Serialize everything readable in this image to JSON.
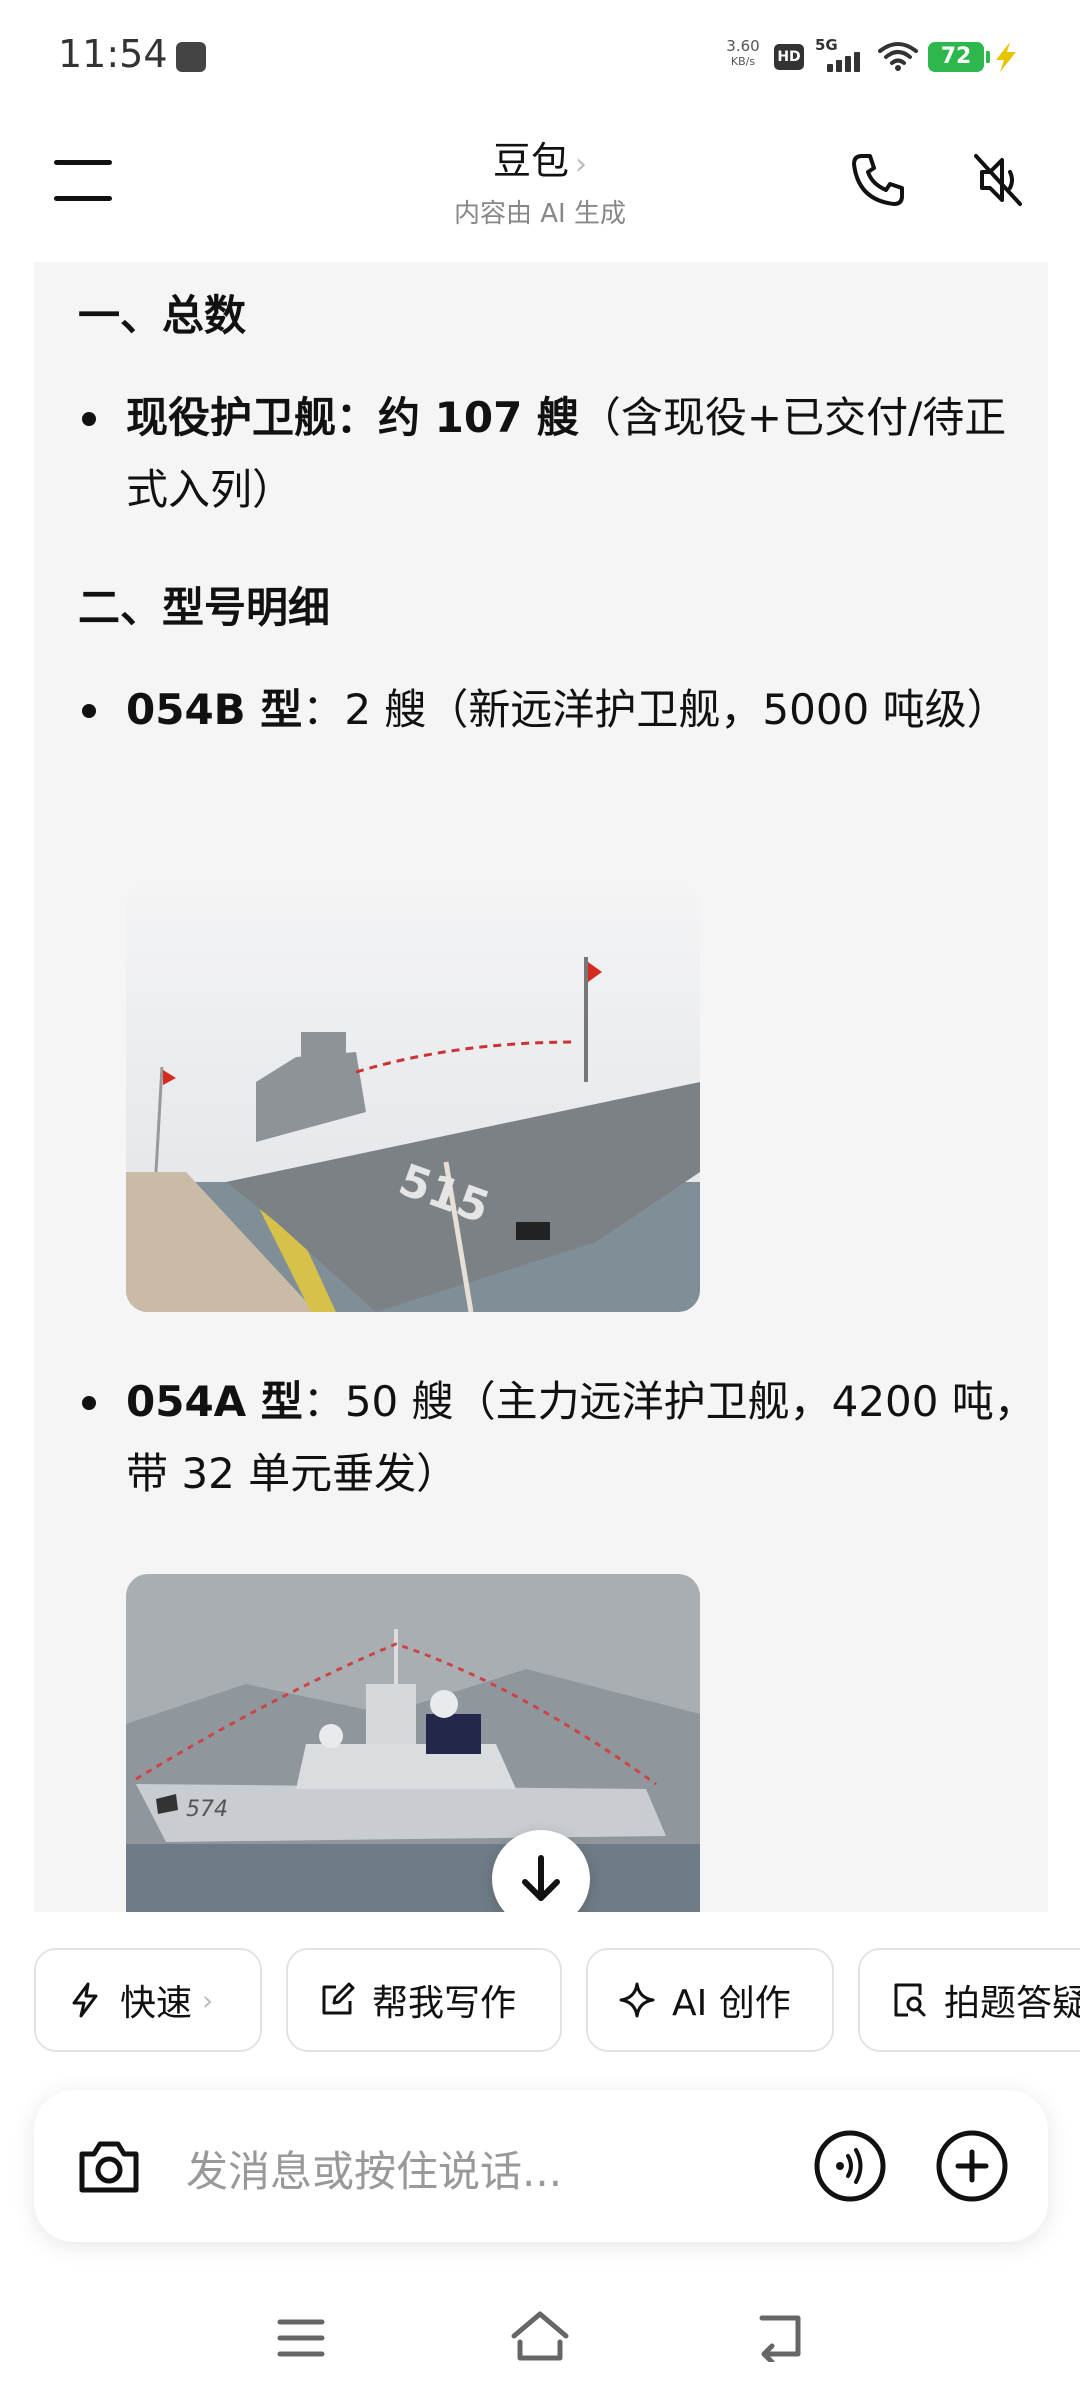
{
  "status_bar": {
    "time": "11:54",
    "net_speed_value": "3.60",
    "net_speed_unit": "KB/s",
    "hd_label": "HD",
    "network_type": "5G",
    "battery_level": "72",
    "battery_color": "#2db84d"
  },
  "header": {
    "title": "豆包",
    "title_chevron": "›",
    "subtitle": "内容由 AI 生成"
  },
  "content": {
    "section1_title": "一、总数",
    "bullet1_bold": "现役护卫舰：约 107 艘",
    "bullet1_rest": "（含现役+已交付/待正式入列）",
    "section2_title": "二、型号明细",
    "bullet2_bold": "054B 型",
    "bullet2_rest": "：2 艘（新远洋护卫舰，5000 吨级）",
    "image1_hull_number": "515",
    "bullet3_bold": "054A 型",
    "bullet3_rest": "：50 艘（主力远洋护卫舰，4200 吨，带 32 单元垂发）",
    "image2_hull_number": "574"
  },
  "chips": [
    {
      "label": "快速",
      "icon": "lightning-icon",
      "chevron": "›"
    },
    {
      "label": "帮我写作",
      "icon": "edit-icon"
    },
    {
      "label": "AI 创作",
      "icon": "sparkle-icon"
    },
    {
      "label": "拍题答疑",
      "icon": "photo-search-icon"
    }
  ],
  "input": {
    "placeholder": "发消息或按住说话..."
  },
  "colors": {
    "accent": "#111111",
    "content_bg": "#f5f5f6",
    "muted_text": "#888888"
  }
}
